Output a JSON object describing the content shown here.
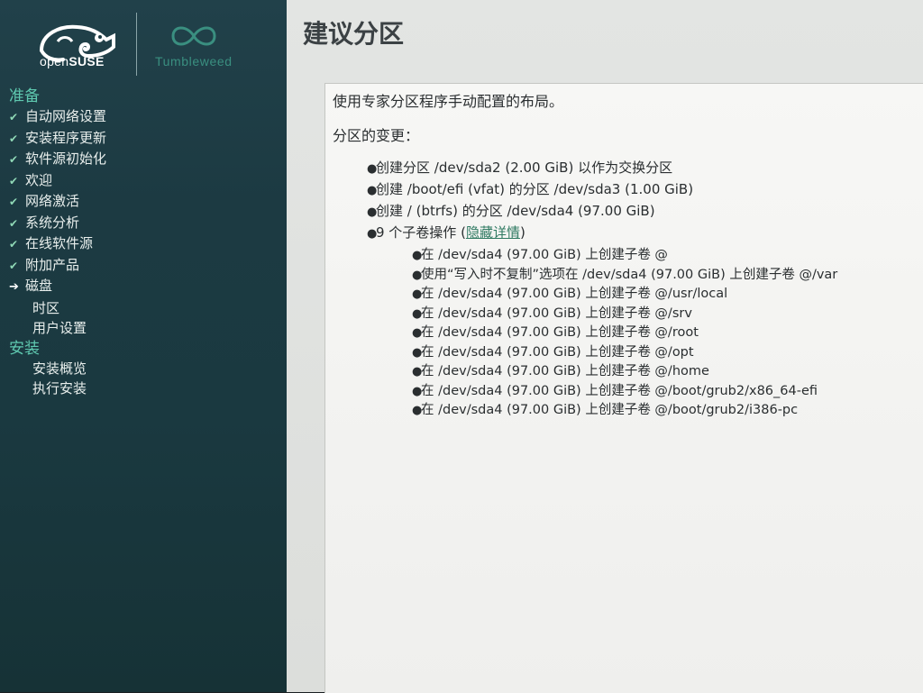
{
  "branding": {
    "opensuse_prefix": "open",
    "opensuse_suffix": "SUSE",
    "tumbleweed": "Tumbleweed"
  },
  "sidebar": {
    "sections": [
      {
        "title": "准备",
        "steps": [
          {
            "label": "自动网络设置",
            "status": "done"
          },
          {
            "label": "安装程序更新",
            "status": "done"
          },
          {
            "label": "软件源初始化",
            "status": "done"
          },
          {
            "label": "欢迎",
            "status": "done"
          },
          {
            "label": "网络激活",
            "status": "done"
          },
          {
            "label": "系统分析",
            "status": "done"
          },
          {
            "label": "在线软件源",
            "status": "done"
          },
          {
            "label": "附加产品",
            "status": "done"
          },
          {
            "label": "磁盘",
            "status": "current"
          },
          {
            "label": "时区",
            "status": "pending"
          },
          {
            "label": "用户设置",
            "status": "pending"
          }
        ]
      },
      {
        "title": "安装",
        "steps": [
          {
            "label": "安装概览",
            "status": "pending"
          },
          {
            "label": "执行安装",
            "status": "pending"
          }
        ]
      }
    ],
    "done_mark": "✔",
    "current_mark": "➔"
  },
  "main": {
    "title": "建议分区",
    "intro": "使用专家分区程序手动配置的布局。",
    "changes_heading": "分区的变更：",
    "changes": [
      "创建分区 /dev/sda2 (2.00 GiB) 以作为交换分区",
      "创建 /boot/efi (vfat) 的分区 /dev/sda3 (1.00 GiB)",
      "创建 / (btrfs) 的分区 /dev/sda4 (97.00 GiB)"
    ],
    "subvol_summary_prefix": "9 个子卷操作 (",
    "subvol_link": "隐藏详情",
    "subvol_summary_suffix": ")",
    "subvolumes": [
      "在 /dev/sda4 (97.00 GiB) 上创建子卷 @",
      "使用“写入时不复制”选项在 /dev/sda4 (97.00 GiB) 上创建子卷 @/var",
      "在 /dev/sda4 (97.00 GiB) 上创建子卷 @/usr/local",
      "在 /dev/sda4 (97.00 GiB) 上创建子卷 @/srv",
      "在 /dev/sda4 (97.00 GiB) 上创建子卷 @/root",
      "在 /dev/sda4 (97.00 GiB) 上创建子卷 @/opt",
      "在 /dev/sda4 (97.00 GiB) 上创建子卷 @/home",
      "在 /dev/sda4 (97.00 GiB) 上创建子卷 @/boot/grub2/x86_64-efi",
      "在 /dev/sda4 (97.00 GiB) 上创建子卷 @/boot/grub2/i386-pc"
    ]
  },
  "colors": {
    "sidebar_bg": "#1c3a42",
    "section_accent": "#5fc9b0",
    "link": "#2f7a62",
    "content_bg": "#f7f7f5"
  }
}
